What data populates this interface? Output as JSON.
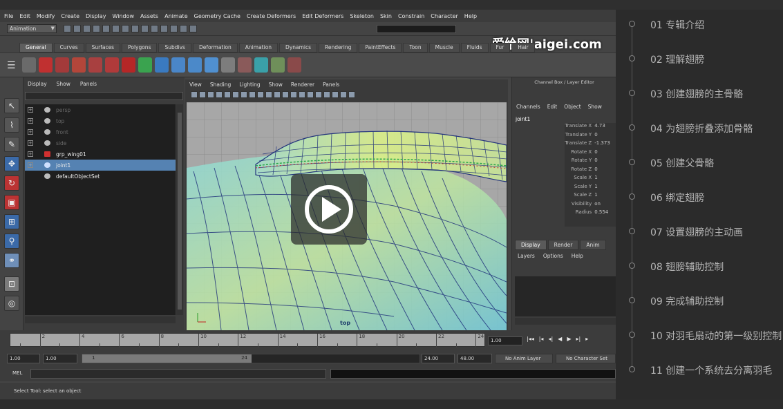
{
  "maya": {
    "menubar": [
      "File",
      "Edit",
      "Modify",
      "Create",
      "Display",
      "Window",
      "Assets",
      "Animate",
      "Geometry Cache",
      "Create Deformers",
      "Edit Deformers",
      "Skeleton",
      "Skin",
      "Constrain",
      "Character",
      "Help"
    ],
    "mode": "Animation",
    "watermark": "爱给网|aigei.com",
    "shelf_tabs": [
      "General",
      "Curves",
      "Surfaces",
      "Polygons",
      "Subdivs",
      "Deformation",
      "Animation",
      "Dynamics",
      "Rendering",
      "PaintEffects",
      "Toon",
      "Muscle",
      "Fluids",
      "Fur",
      "Hair"
    ],
    "outliner": {
      "menu": [
        "Display",
        "Show",
        "Panels"
      ],
      "items": [
        {
          "label": "persp",
          "dim": true
        },
        {
          "label": "top",
          "dim": true
        },
        {
          "label": "front",
          "dim": true
        },
        {
          "label": "side",
          "dim": true
        },
        {
          "label": "grp_wing01",
          "dim": false
        },
        {
          "label": "joint1",
          "dim": false,
          "selected": true
        },
        {
          "label": "defaultObjectSet",
          "dim": false
        }
      ]
    },
    "viewport": {
      "menu": [
        "View",
        "Shading",
        "Lighting",
        "Show",
        "Renderer",
        "Panels"
      ],
      "camera": "top"
    },
    "channel_box": {
      "title": "Channel Box / Layer Editor",
      "menu": [
        "Channels",
        "Edit",
        "Object",
        "Show"
      ],
      "object": "joint1",
      "attributes": [
        {
          "name": "Translate X",
          "value": "4.73"
        },
        {
          "name": "Translate Y",
          "value": "0"
        },
        {
          "name": "Translate Z",
          "value": "-1.373"
        },
        {
          "name": "Rotate X",
          "value": "0"
        },
        {
          "name": "Rotate Y",
          "value": "0"
        },
        {
          "name": "Rotate Z",
          "value": "0"
        },
        {
          "name": "Scale X",
          "value": "1"
        },
        {
          "name": "Scale Y",
          "value": "1"
        },
        {
          "name": "Scale Z",
          "value": "1"
        },
        {
          "name": "Visibility",
          "value": "on"
        },
        {
          "name": "Radius",
          "value": "0.554"
        }
      ],
      "layer_tabs": [
        "Display",
        "Render",
        "Anim"
      ],
      "layer_menu": [
        "Layers",
        "Options",
        "Help"
      ]
    },
    "timeline": {
      "labels": [
        "2",
        "4",
        "6",
        "8",
        "10",
        "12",
        "14",
        "16",
        "18",
        "20",
        "22",
        "24"
      ],
      "current_frame": "1.00"
    },
    "range": {
      "start": "1.00",
      "playback_start": "1.00",
      "thumb_start": "1",
      "thumb_end": "24",
      "playback_end": "24.00",
      "end": "48.00",
      "anim_layer": "No Anim Layer",
      "character_set": "No Character Set"
    },
    "mel_label": "MEL",
    "help_line": "Select Tool: select an object"
  },
  "playlist": {
    "items": [
      "01 专辑介绍",
      "02 理解翅膀",
      "03 创建翅膀的主骨骼",
      "04 为翅膀折叠添加骨骼",
      "05 创建父骨骼",
      "06 绑定翅膀",
      "07 设置翅膀的主动画",
      "08 翅膀辅助控制",
      "09 完成辅助控制",
      "10 对羽毛扇动的第一级别控制",
      "11 创建一个系统去分离羽毛"
    ]
  }
}
